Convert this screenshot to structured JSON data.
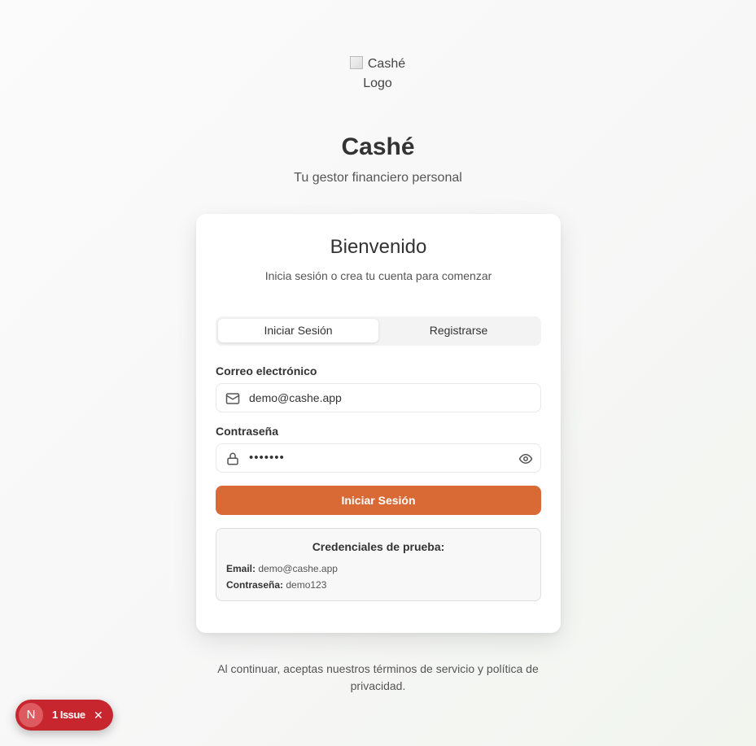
{
  "brand": {
    "logo_alt": "Cashé Logo",
    "title": "Cashé",
    "subtitle": "Tu gestor financiero personal"
  },
  "card": {
    "title": "Bienvenido",
    "subtitle": "Inicia sesión o crea tu cuenta para comenzar",
    "tabs": [
      {
        "label": "Iniciar Sesión",
        "active": true
      },
      {
        "label": "Registrarse",
        "active": false
      }
    ],
    "email": {
      "label": "Correo electrónico",
      "value": "demo@cashe.app",
      "icon": "mail-icon"
    },
    "password": {
      "label": "Contraseña",
      "value": "•••••••",
      "icon": "lock-icon",
      "toggle_icon": "eye-icon"
    },
    "submit_label": "Iniciar Sesión",
    "test_credentials": {
      "title": "Credenciales de prueba:",
      "email_key": "Email:",
      "email_value": "demo@cashe.app",
      "password_key": "Contraseña:",
      "password_value": "demo123"
    }
  },
  "footer": {
    "line1": "Al continuar, aceptas nuestros términos de servicio y política de",
    "line2": "privacidad."
  },
  "dev_overlay": {
    "logo_letter": "N",
    "issues_label": "1 Issue",
    "close_glyph": "✕"
  },
  "colors": {
    "accent": "#d96a35",
    "issue_badge": "#c8262f"
  }
}
